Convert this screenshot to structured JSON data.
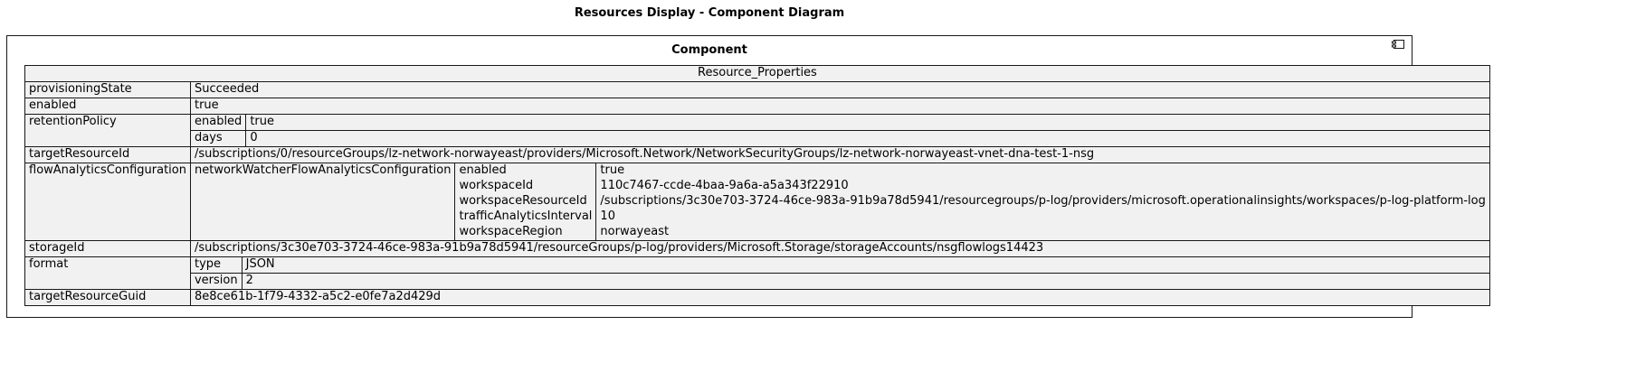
{
  "diagram": {
    "title": "Resources Display - Component Diagram",
    "component_title": "Component",
    "table_header": "Resource_Properties",
    "component_icon": "component-icon"
  },
  "props": {
    "provisioningState": {
      "key": "provisioningState",
      "value": "Succeeded"
    },
    "enabled": {
      "key": "enabled",
      "value": "true"
    },
    "retentionPolicy": {
      "key": "retentionPolicy",
      "enabled_key": "enabled",
      "enabled_value": "true",
      "days_key": "days",
      "days_value": "0"
    },
    "targetResourceId": {
      "key": "targetResourceId",
      "value": "/subscriptions/0/resourceGroups/lz-network-norwayeast/providers/Microsoft.Network/NetworkSecurityGroups/lz-network-norwayeast-vnet-dna-test-1-nsg"
    },
    "flowAnalyticsConfiguration": {
      "key": "flowAnalyticsConfiguration",
      "sub_key": "networkWatcherFlowAnalyticsConfiguration",
      "enabled_key": "enabled",
      "enabled_value": "true",
      "workspaceId_key": "workspaceId",
      "workspaceId_value": "110c7467-ccde-4baa-9a6a-a5a343f22910",
      "workspaceResourceId_key": "workspaceResourceId",
      "workspaceResourceId_value": "/subscriptions/3c30e703-3724-46ce-983a-91b9a78d5941/resourcegroups/p-log/providers/microsoft.operationalinsights/workspaces/p-log-platform-log",
      "trafficAnalyticsInterval_key": "trafficAnalyticsInterval",
      "trafficAnalyticsInterval_value": "10",
      "workspaceRegion_key": "workspaceRegion",
      "workspaceRegion_value": "norwayeast"
    },
    "storageId": {
      "key": "storageId",
      "value": "/subscriptions/3c30e703-3724-46ce-983a-91b9a78d5941/resourceGroups/p-log/providers/Microsoft.Storage/storageAccounts/nsgflowlogs14423"
    },
    "format": {
      "key": "format",
      "type_key": "type",
      "type_value": "JSON",
      "version_key": "version",
      "version_value": "2"
    },
    "targetResourceGuid": {
      "key": "targetResourceGuid",
      "value": "8e8ce61b-1f79-4332-a5c2-e0fe7a2d429d"
    }
  }
}
